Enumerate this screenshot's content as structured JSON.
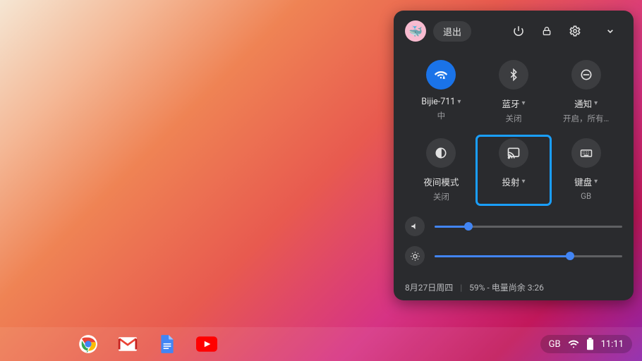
{
  "panel": {
    "signout": "退出",
    "tiles": [
      {
        "label": "Bijie-711",
        "sub": "中",
        "dropdown": true,
        "active": true
      },
      {
        "label": "蓝牙",
        "sub": "关闭",
        "dropdown": true,
        "active": false
      },
      {
        "label": "通知",
        "sub": "开启，所有…",
        "dropdown": true,
        "active": false
      },
      {
        "label": "夜间模式",
        "sub": "关闭",
        "dropdown": false,
        "active": false
      },
      {
        "label": "投射",
        "sub": "",
        "dropdown": true,
        "active": false,
        "highlighted": true
      },
      {
        "label": "键盘",
        "sub": "GB",
        "dropdown": true,
        "active": false
      }
    ],
    "volume_pct": 18,
    "brightness_pct": 72,
    "date": "8月27日周四",
    "battery_text": "59% - 电量尚余 3:26"
  },
  "status": {
    "ime": "GB",
    "clock": "11:11"
  }
}
